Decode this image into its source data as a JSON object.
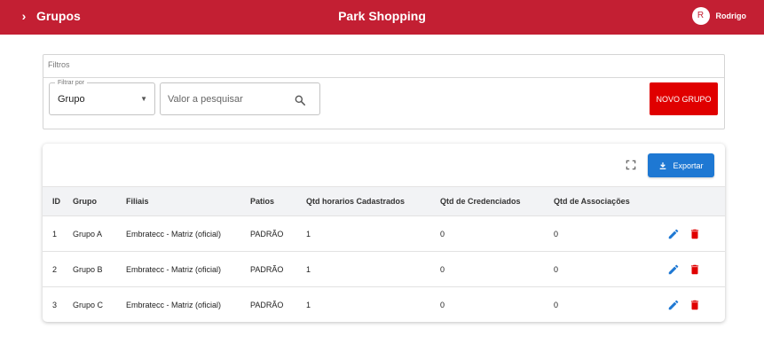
{
  "header": {
    "section_title": "Grupos",
    "app_title": "Park Shopping",
    "user_initial": "R",
    "user_name": "Rodrigo"
  },
  "filters": {
    "title": "Filtros",
    "filter_by_label": "Filtrar por",
    "filter_by_value": "Grupo",
    "search_placeholder": "Valor a pesquisar",
    "search_value": "",
    "new_group_label": "NOVO GRUPO"
  },
  "table": {
    "export_label": "Exportar",
    "columns": [
      "ID",
      "Grupo",
      "Filiais",
      "Patios",
      "Qtd horarios Cadastrados",
      "Qtd de Credenciados",
      "Qtd de Associações"
    ],
    "rows": [
      {
        "id": "1",
        "grupo": "Grupo A",
        "filiais": "Embratecc - Matriz (oficial)",
        "patios": "PADRÃO",
        "horarios": "1",
        "credenciados": "0",
        "associacoes": "0"
      },
      {
        "id": "2",
        "grupo": "Grupo B",
        "filiais": "Embratecc - Matriz (oficial)",
        "patios": "PADRÃO",
        "horarios": "1",
        "credenciados": "0",
        "associacoes": "0"
      },
      {
        "id": "3",
        "grupo": "Grupo C",
        "filiais": "Embratecc - Matriz (oficial)",
        "patios": "PADRÃO",
        "horarios": "1",
        "credenciados": "0",
        "associacoes": "0"
      }
    ]
  },
  "colors": {
    "header_bg": "#c31f33",
    "new_group_bg": "#e00000",
    "export_bg": "#1e78d3",
    "edit_icon": "#1e78d3",
    "delete_icon": "#e00000"
  },
  "icons": [
    "chevron-right-icon",
    "search-icon",
    "dropdown-caret-icon",
    "fullscreen-icon",
    "download-icon",
    "edit-pencil-icon",
    "delete-trash-icon"
  ]
}
